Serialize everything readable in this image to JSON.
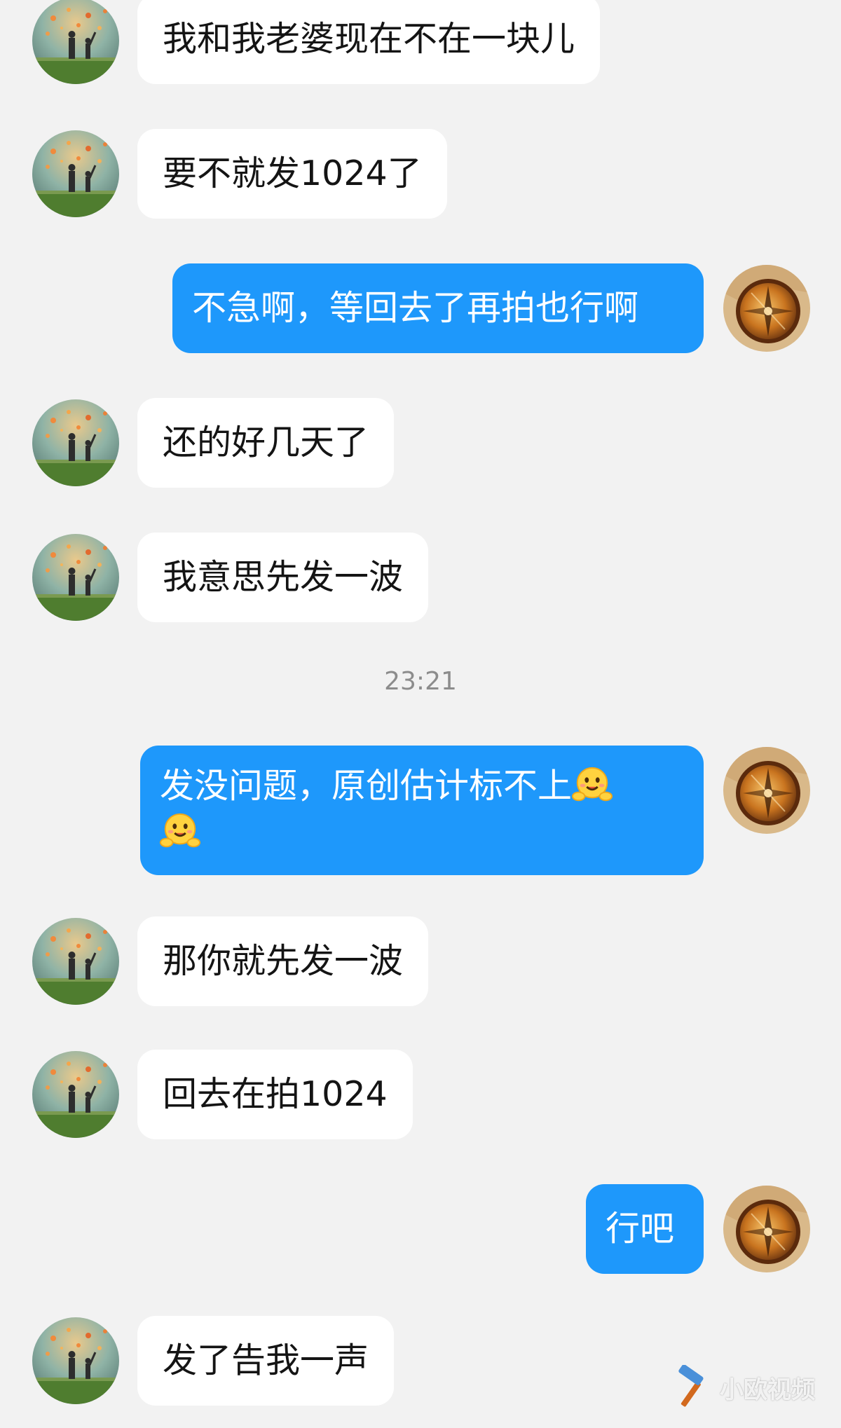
{
  "conversation": {
    "messages": [
      {
        "sender": "contact",
        "text": "我和我老婆现在不在一块儿"
      },
      {
        "sender": "contact",
        "text": "要不就发1024了"
      },
      {
        "sender": "me",
        "text": "不急啊，等回去了再拍也行啊"
      },
      {
        "sender": "contact",
        "text": "还的好几天了"
      },
      {
        "sender": "contact",
        "text": "我意思先发一波"
      },
      {
        "sender": "me",
        "text": "发没问题，原创估计标不上",
        "emoji": [
          "smile-face-emoji",
          "smile-face-emoji"
        ]
      },
      {
        "sender": "contact",
        "text": "那你就先发一波"
      },
      {
        "sender": "contact",
        "text": "回去在拍1024"
      },
      {
        "sender": "me",
        "text": "行吧"
      },
      {
        "sender": "contact",
        "text": "发了告我一声"
      }
    ],
    "timestamp": "23:21"
  },
  "colors": {
    "background": "#f2f2f2",
    "incoming_bubble": "#ffffff",
    "outgoing_bubble": "#1e98fb",
    "timestamp": "#8c8c8c"
  },
  "watermark": {
    "text": "小欧视频",
    "icon": "hammer-icon"
  }
}
